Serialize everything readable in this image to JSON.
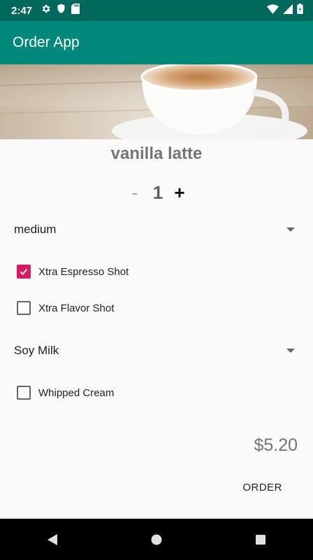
{
  "status_bar": {
    "time": "2:47",
    "icons_left": [
      "gear-icon",
      "shield-icon",
      "sd-card-icon"
    ],
    "icons_right": [
      "wifi-icon",
      "signal-icon",
      "battery-icon"
    ]
  },
  "app_bar": {
    "title": "Order App",
    "color": "#00897b",
    "status_color": "#00695c"
  },
  "hero": {
    "image": "coffee-cup-image"
  },
  "product": {
    "name": "vanilla latte"
  },
  "quantity": {
    "minus": "-",
    "value": "1",
    "plus": "+"
  },
  "size_spinner": {
    "selected": "medium"
  },
  "addons": [
    {
      "label": "Xtra Espresso Shot",
      "checked": true
    },
    {
      "label": "Xtra Flavor Shot",
      "checked": false
    }
  ],
  "milk_spinner": {
    "selected": "Soy Milk"
  },
  "toppings": [
    {
      "label": "Whipped Cream",
      "checked": false
    }
  ],
  "price": "$5.20",
  "order_button": {
    "label": "ORDER"
  },
  "accent_color": "#d81b60",
  "nav_bar": {
    "icons": [
      "back-icon",
      "home-icon",
      "recents-icon"
    ]
  }
}
